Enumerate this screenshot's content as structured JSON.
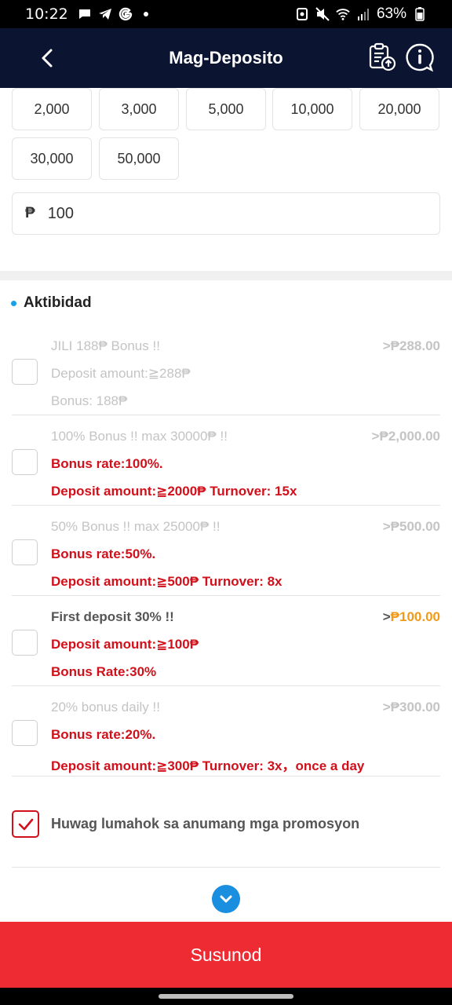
{
  "status_bar": {
    "time": "10:22",
    "battery": "63%",
    "left_icons": [
      "chat-icon",
      "telegram-icon",
      "google-icon",
      "dot-icon"
    ],
    "right_icons": [
      "notification-icon",
      "mute-icon",
      "wifi-icon",
      "signal-icon",
      "battery-icon"
    ]
  },
  "header": {
    "title": "Mag-Deposito",
    "icons": [
      "back-icon",
      "deposit-record-icon",
      "help-chat-icon"
    ]
  },
  "amounts": {
    "chips": [
      "2,000",
      "3,000",
      "5,000",
      "10,000",
      "20,000",
      "30,000",
      "50,000"
    ],
    "currency_symbol": "₱",
    "input_value": "100"
  },
  "activity": {
    "title": "Aktibidad",
    "promotions": [
      {
        "title": "JILI 188₱ Bonus !!",
        "lines": [
          "Deposit amount:≧288₱",
          "Bonus: 188₱"
        ],
        "lines_style": "muted",
        "amount_prefix": ">",
        "amount": "₱288.00",
        "active": false,
        "checked": false
      },
      {
        "title": "100% Bonus !! max 30000₱ !!",
        "lines": [
          "Bonus rate:100%.",
          "Deposit amount:≧2000₱ Turnover: 15x"
        ],
        "lines_style": "red",
        "amount_prefix": ">",
        "amount": "₱2,000.00",
        "active": false,
        "checked": false
      },
      {
        "title": "50% Bonus !! max 25000₱ !!",
        "lines": [
          "Bonus rate:50%.",
          "Deposit amount:≧500₱ Turnover: 8x"
        ],
        "lines_style": "red",
        "amount_prefix": ">",
        "amount": "₱500.00",
        "active": false,
        "checked": false
      },
      {
        "title": "First deposit 30% !!",
        "lines": [
          "Deposit amount:≧100₱",
          "Bonus Rate:30%"
        ],
        "lines_style": "red",
        "amount_prefix": ">",
        "amount": "₱100.00",
        "active": true,
        "checked": false
      },
      {
        "title": "20% bonus daily !!",
        "lines": [
          "Bonus rate:20%.",
          "Deposit amount:≧300₱ Turnover: 3x，once a day"
        ],
        "lines_style": "red",
        "amount_prefix": ">",
        "amount": "₱300.00",
        "active": false,
        "checked": false
      }
    ],
    "opt_out": {
      "label": "Huwag lumahok sa anumang mga promosyon",
      "checked": true
    }
  },
  "submit_label": "Susunod",
  "colors": {
    "header_bg": "#0b1430",
    "accent_red": "#ee2a33",
    "text_red": "#d0101a",
    "highlight_orange": "#f19a19",
    "link_blue": "#1a8fe0"
  }
}
